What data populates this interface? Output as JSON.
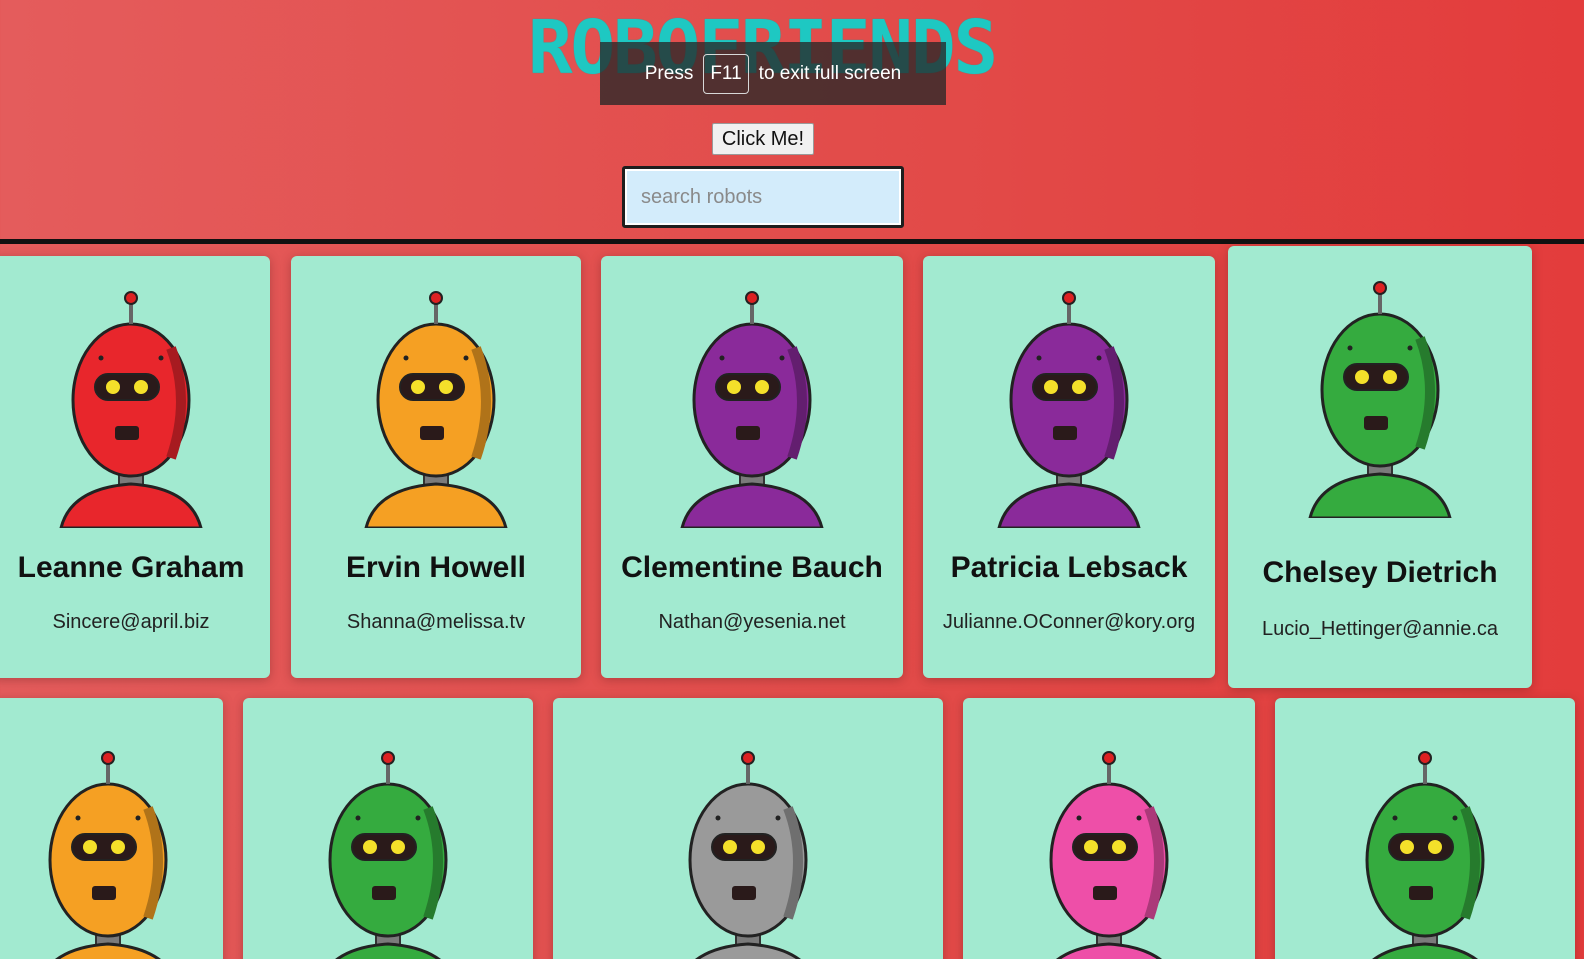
{
  "header": {
    "title": "ROBOFRIENDS",
    "fullscreen_notice": {
      "prefix": "Press",
      "key": "F11",
      "suffix": "to exit full screen"
    },
    "button_label": "Click Me!",
    "search_placeholder": "search robots"
  },
  "colors": {
    "background": "#e24a48",
    "card": "#a2ead0",
    "title": "#1ec8c2"
  },
  "robots": [
    {
      "name": "Leanne Graham",
      "email": "Sincere@april.biz",
      "color": "#e8262c"
    },
    {
      "name": "Ervin Howell",
      "email": "Shanna@melissa.tv",
      "color": "#f5a023"
    },
    {
      "name": "Clementine Bauch",
      "email": "Nathan@yesenia.net",
      "color": "#8a2a9a"
    },
    {
      "name": "Patricia Lebsack",
      "email": "Julianne.OConner@kory.org",
      "color": "#8a2a9a"
    },
    {
      "name": "Chelsey Dietrich",
      "email": "Lucio_Hettinger@annie.ca",
      "color": "#35ab3f"
    },
    {
      "color": "#f5a023"
    },
    {
      "color": "#35ab3f"
    },
    {
      "color": "#9a9a9a"
    },
    {
      "color": "#ee4fa8"
    },
    {
      "color": "#35ab3f"
    }
  ]
}
